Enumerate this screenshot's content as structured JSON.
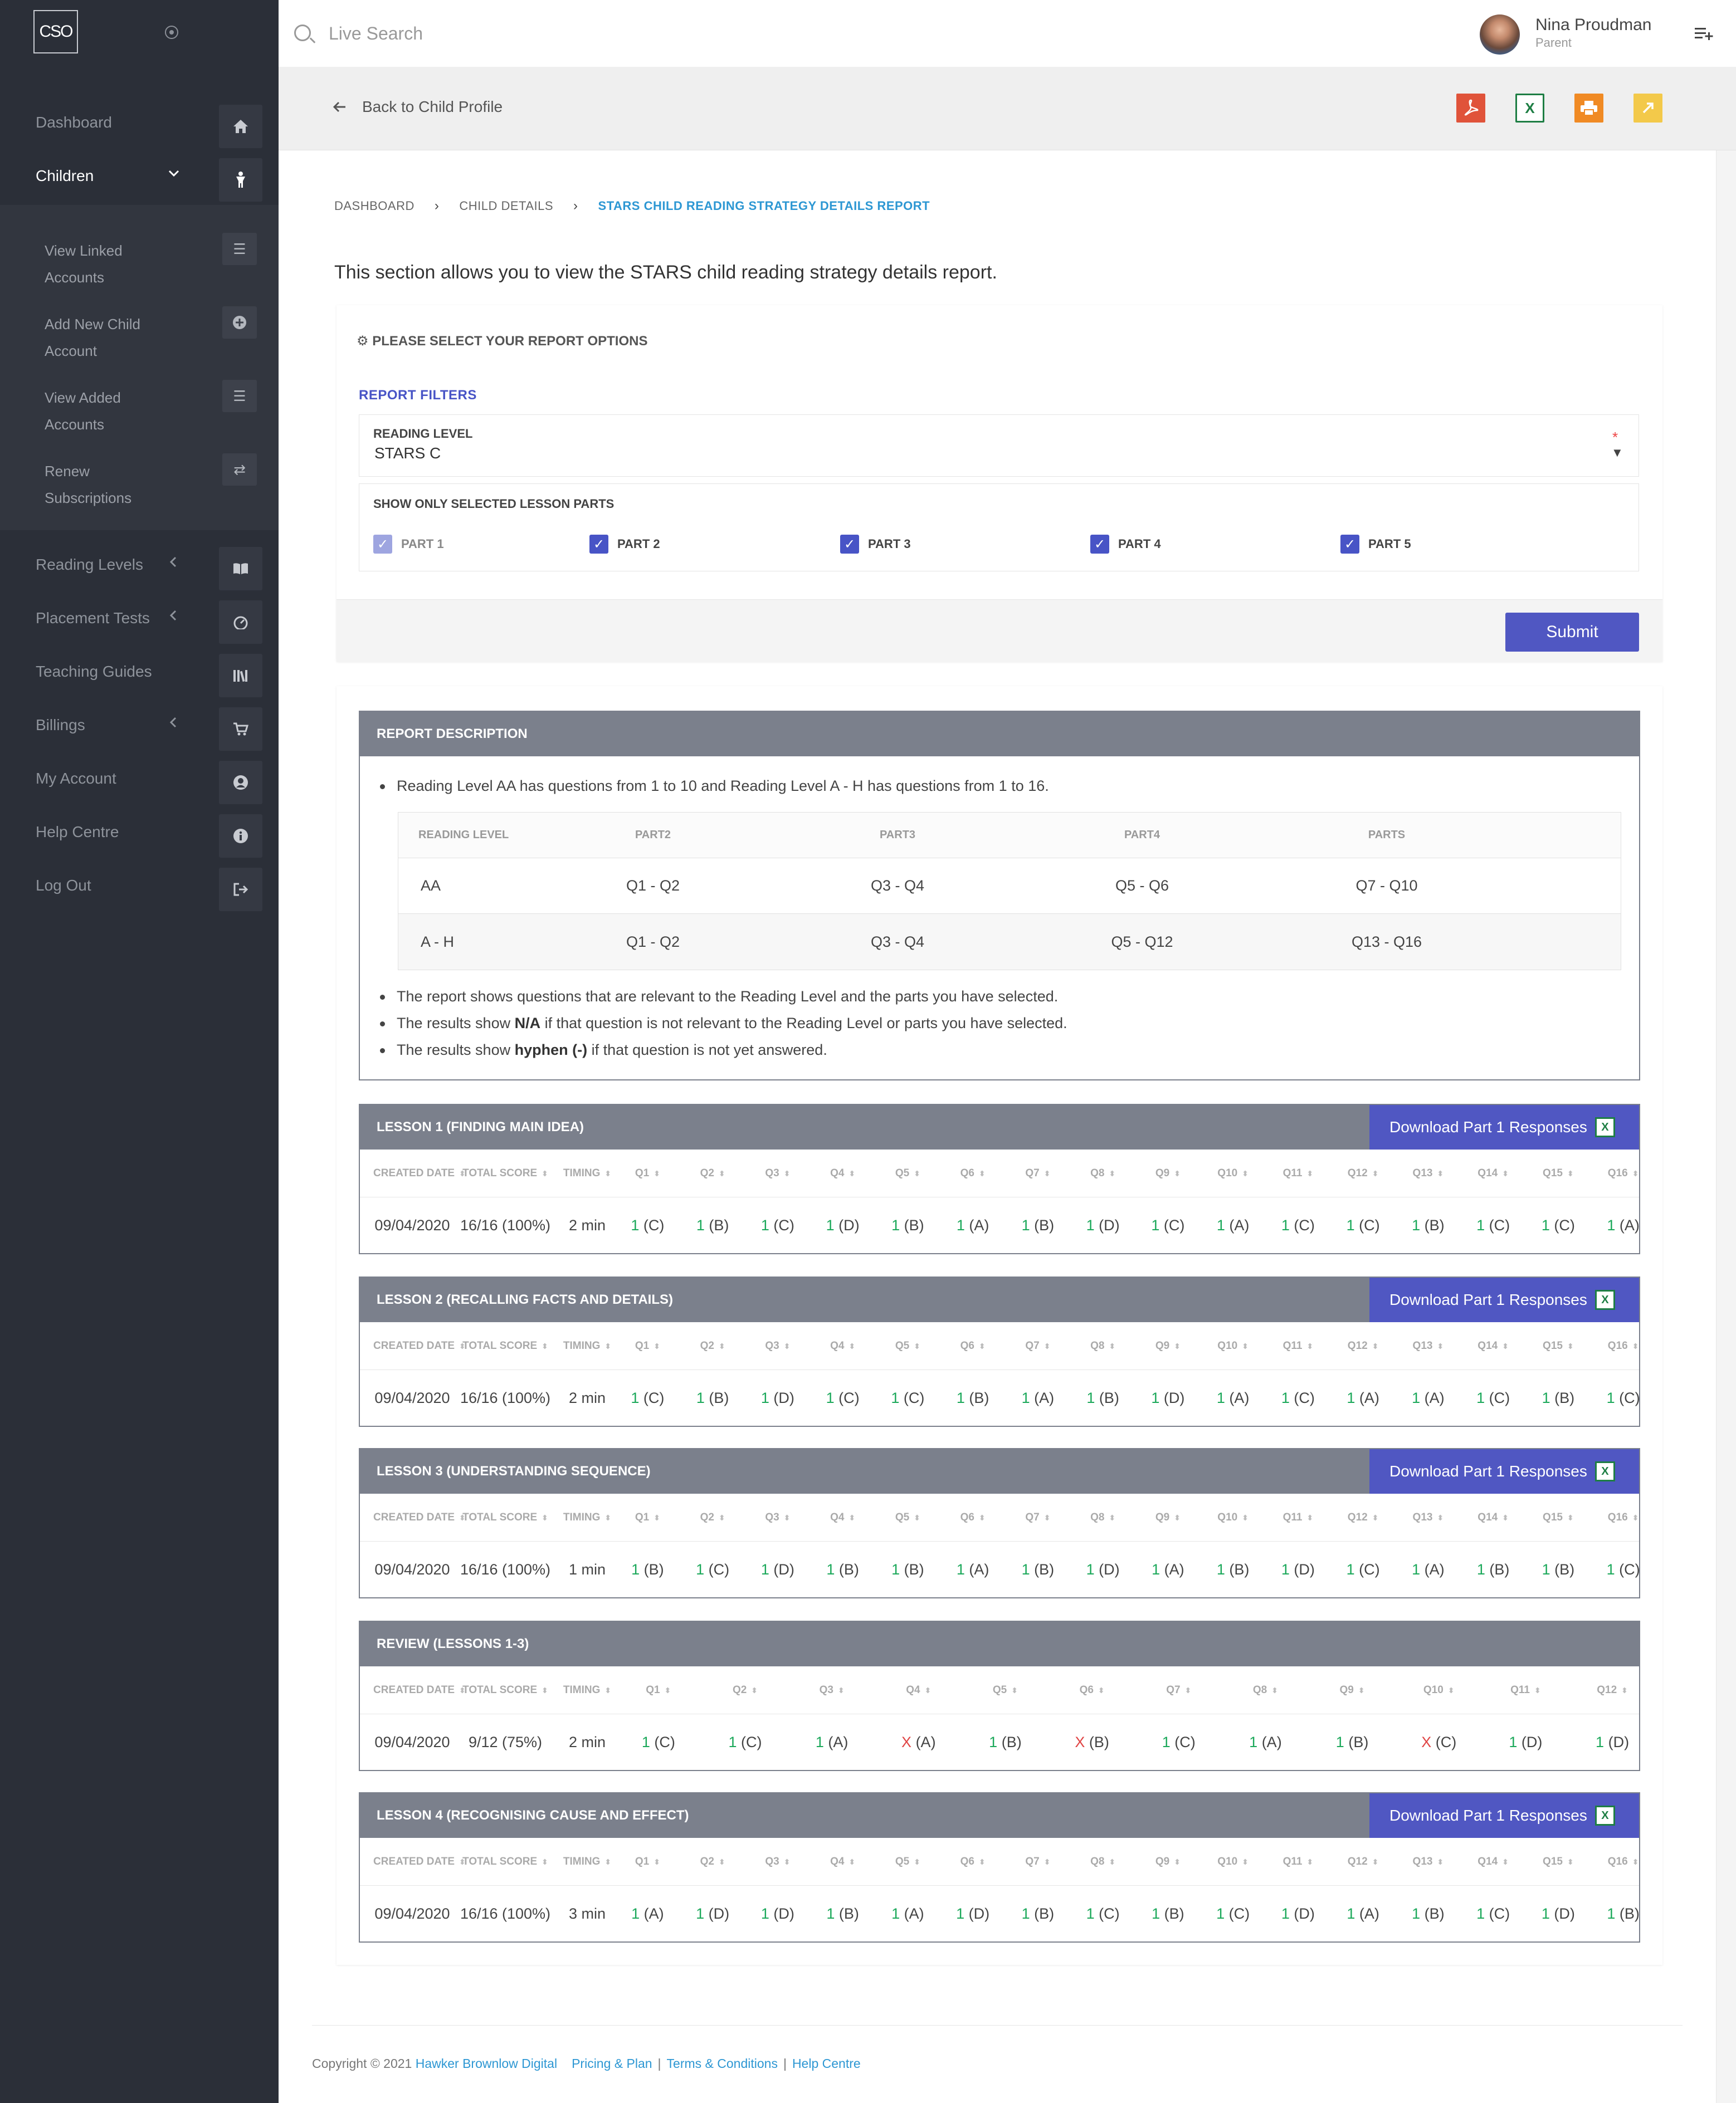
{
  "topbar": {
    "search_placeholder": "Live Search",
    "user_name": "Nina Proudman",
    "user_role": "Parent"
  },
  "sidebar": {
    "logo_text": "CSO",
    "items": [
      {
        "label": "Dashboard",
        "icon": "home-icon"
      },
      {
        "label": "Children",
        "icon": "child-icon",
        "active": true,
        "chevron": "down"
      },
      {
        "label": "Reading Levels",
        "icon": "book-icon",
        "chevron": "left"
      },
      {
        "label": "Placement Tests",
        "icon": "gauge-icon",
        "chevron": "left"
      },
      {
        "label": "Teaching Guides",
        "icon": "library-icon"
      },
      {
        "label": "Billings",
        "icon": "cart-icon",
        "chevron": "left"
      },
      {
        "label": "My Account",
        "icon": "user-circle-icon"
      },
      {
        "label": "Help Centre",
        "icon": "info-icon"
      },
      {
        "label": "Log Out",
        "icon": "logout-icon"
      }
    ],
    "sub_items": [
      {
        "label": "View Linked Accounts",
        "icon": "list-icon"
      },
      {
        "label": "Add New Child Account",
        "icon": "plus-circle-icon"
      },
      {
        "label": "View Added Accounts",
        "icon": "list-icon"
      },
      {
        "label": "Renew Subscriptions",
        "icon": "repeat-icon"
      }
    ]
  },
  "subbar": {
    "back_label": "Back to Child Profile",
    "export_icons": [
      "pdf-icon",
      "excel-icon",
      "print-icon",
      "share-icon"
    ],
    "export_colors": [
      "#e0533a",
      "#1e7e44",
      "#f08a24",
      "#f3c94a"
    ]
  },
  "breadcrumb": [
    "DASHBOARD",
    "CHILD DETAILS",
    "STARS CHILD READING STRATEGY DETAILS REPORT"
  ],
  "intro": "This section allows you to view the STARS child reading strategy details report.",
  "options": {
    "title": "PLEASE SELECT YOUR REPORT OPTIONS",
    "filters_title": "REPORT FILTERS",
    "reading_level_label": "READING LEVEL",
    "reading_level_value": "STARS C",
    "required_mark": "*",
    "parts_label": "SHOW ONLY SELECTED LESSON PARTS",
    "parts": [
      {
        "label": "PART 1",
        "checked": true,
        "disabled": true
      },
      {
        "label": "PART 2",
        "checked": true
      },
      {
        "label": "PART 3",
        "checked": true
      },
      {
        "label": "PART 4",
        "checked": true
      },
      {
        "label": "PART 5",
        "checked": true
      }
    ],
    "submit_label": "Submit"
  },
  "description": {
    "title": "REPORT DESCRIPTION",
    "bullet1": "Reading Level AA has questions from 1 to 10 and Reading Level A - H has questions from 1 to 16.",
    "table_headers": [
      "READING LEVEL",
      "PART2",
      "PART3",
      "PART4",
      "PARTS"
    ],
    "table_rows": [
      [
        "AA",
        "Q1 - Q2",
        "Q3 - Q4",
        "Q5 - Q6",
        "Q7 - Q10"
      ],
      [
        "A - H",
        "Q1 - Q2",
        "Q3 - Q4",
        "Q5 - Q12",
        "Q13 - Q16"
      ]
    ],
    "bullet2": "The report shows questions that are relevant to the Reading Level and the parts you have selected.",
    "bullet3_pre": "The results show ",
    "bullet3_bold": "N/A",
    "bullet3_post": " if that question is not relevant to the Reading Level or parts you have selected.",
    "bullet4_pre": "The results show ",
    "bullet4_bold": "hyphen (-)",
    "bullet4_post": " if that question is not yet answered."
  },
  "lessons": [
    {
      "title": "LESSON 1 (FINDING MAIN IDEA)",
      "download": "Download Part 1 Responses",
      "headers": [
        "CREATED DATE",
        "TOTAL SCORE",
        "TIMING",
        "Q1",
        "Q2",
        "Q3",
        "Q4",
        "Q5",
        "Q6",
        "Q7",
        "Q8",
        "Q9",
        "Q10",
        "Q11",
        "Q12",
        "Q13",
        "Q14",
        "Q15",
        "Q16"
      ],
      "row": {
        "date": "09/04/2020",
        "score": "16/16 (100%)",
        "timing": "2 min",
        "answers": [
          [
            "1",
            "(C)"
          ],
          [
            "1",
            "(B)"
          ],
          [
            "1",
            "(C)"
          ],
          [
            "1",
            "(D)"
          ],
          [
            "1",
            "(B)"
          ],
          [
            "1",
            "(A)"
          ],
          [
            "1",
            "(B)"
          ],
          [
            "1",
            "(D)"
          ],
          [
            "1",
            "(C)"
          ],
          [
            "1",
            "(A)"
          ],
          [
            "1",
            "(C)"
          ],
          [
            "1",
            "(C)"
          ],
          [
            "1",
            "(B)"
          ],
          [
            "1",
            "(C)"
          ],
          [
            "1",
            "(C)"
          ],
          [
            "1",
            "(A)"
          ]
        ]
      }
    },
    {
      "title": "LESSON 2 (RECALLING FACTS AND DETAILS)",
      "download": "Download Part 1 Responses",
      "headers": [
        "CREATED DATE",
        "TOTAL SCORE",
        "TIMING",
        "Q1",
        "Q2",
        "Q3",
        "Q4",
        "Q5",
        "Q6",
        "Q7",
        "Q8",
        "Q9",
        "Q10",
        "Q11",
        "Q12",
        "Q13",
        "Q14",
        "Q15",
        "Q16"
      ],
      "row": {
        "date": "09/04/2020",
        "score": "16/16 (100%)",
        "timing": "2 min",
        "answers": [
          [
            "1",
            "(C)"
          ],
          [
            "1",
            "(B)"
          ],
          [
            "1",
            "(D)"
          ],
          [
            "1",
            "(C)"
          ],
          [
            "1",
            "(C)"
          ],
          [
            "1",
            "(B)"
          ],
          [
            "1",
            "(A)"
          ],
          [
            "1",
            "(B)"
          ],
          [
            "1",
            "(D)"
          ],
          [
            "1",
            "(A)"
          ],
          [
            "1",
            "(C)"
          ],
          [
            "1",
            "(A)"
          ],
          [
            "1",
            "(A)"
          ],
          [
            "1",
            "(C)"
          ],
          [
            "1",
            "(B)"
          ],
          [
            "1",
            "(C)"
          ]
        ]
      }
    },
    {
      "title": "LESSON 3 (UNDERSTANDING SEQUENCE)",
      "download": "Download Part 1 Responses",
      "headers": [
        "CREATED DATE",
        "TOTAL SCORE",
        "TIMING",
        "Q1",
        "Q2",
        "Q3",
        "Q4",
        "Q5",
        "Q6",
        "Q7",
        "Q8",
        "Q9",
        "Q10",
        "Q11",
        "Q12",
        "Q13",
        "Q14",
        "Q15",
        "Q16"
      ],
      "row": {
        "date": "09/04/2020",
        "score": "16/16 (100%)",
        "timing": "1 min",
        "answers": [
          [
            "1",
            "(B)"
          ],
          [
            "1",
            "(C)"
          ],
          [
            "1",
            "(D)"
          ],
          [
            "1",
            "(B)"
          ],
          [
            "1",
            "(B)"
          ],
          [
            "1",
            "(A)"
          ],
          [
            "1",
            "(B)"
          ],
          [
            "1",
            "(D)"
          ],
          [
            "1",
            "(A)"
          ],
          [
            "1",
            "(B)"
          ],
          [
            "1",
            "(D)"
          ],
          [
            "1",
            "(C)"
          ],
          [
            "1",
            "(A)"
          ],
          [
            "1",
            "(B)"
          ],
          [
            "1",
            "(B)"
          ],
          [
            "1",
            "(C)"
          ]
        ]
      }
    },
    {
      "title": "REVIEW (LESSONS 1-3)",
      "download": "",
      "headers": [
        "CREATED DATE",
        "TOTAL SCORE",
        "TIMING",
        "Q1",
        "Q2",
        "Q3",
        "Q4",
        "Q5",
        "Q6",
        "Q7",
        "Q8",
        "Q9",
        "Q10",
        "Q11",
        "Q12"
      ],
      "row": {
        "date": "09/04/2020",
        "score": "9/12 (75%)",
        "timing": "2 min",
        "answers": [
          [
            "1",
            "(C)"
          ],
          [
            "1",
            "(C)"
          ],
          [
            "1",
            "(A)"
          ],
          [
            "X",
            "(A)"
          ],
          [
            "1",
            "(B)"
          ],
          [
            "X",
            "(B)"
          ],
          [
            "1",
            "(C)"
          ],
          [
            "1",
            "(A)"
          ],
          [
            "1",
            "(B)"
          ],
          [
            "X",
            "(C)"
          ],
          [
            "1",
            "(D)"
          ],
          [
            "1",
            "(D)"
          ]
        ]
      }
    },
    {
      "title": "LESSON 4 (RECOGNISING CAUSE AND EFFECT)",
      "download": "Download Part 1 Responses",
      "headers": [
        "CREATED DATE",
        "TOTAL SCORE",
        "TIMING",
        "Q1",
        "Q2",
        "Q3",
        "Q4",
        "Q5",
        "Q6",
        "Q7",
        "Q8",
        "Q9",
        "Q10",
        "Q11",
        "Q12",
        "Q13",
        "Q14",
        "Q15",
        "Q16"
      ],
      "row": {
        "date": "09/04/2020",
        "score": "16/16 (100%)",
        "timing": "3 min",
        "answers": [
          [
            "1",
            "(A)"
          ],
          [
            "1",
            "(D)"
          ],
          [
            "1",
            "(D)"
          ],
          [
            "1",
            "(B)"
          ],
          [
            "1",
            "(A)"
          ],
          [
            "1",
            "(D)"
          ],
          [
            "1",
            "(B)"
          ],
          [
            "1",
            "(C)"
          ],
          [
            "1",
            "(B)"
          ],
          [
            "1",
            "(C)"
          ],
          [
            "1",
            "(D)"
          ],
          [
            "1",
            "(A)"
          ],
          [
            "1",
            "(B)"
          ],
          [
            "1",
            "(C)"
          ],
          [
            "1",
            "(D)"
          ],
          [
            "1",
            "(B)"
          ]
        ]
      }
    }
  ],
  "footer": {
    "copyright": "Copyright © 2021",
    "company": "Hawker Brownlow Digital",
    "links": [
      "Pricing & Plan",
      "Terms & Conditions",
      "Help Centre"
    ]
  },
  "colors": {
    "sidebar_bg": "#2b2f38",
    "accent": "#5057c2",
    "panel_header": "#7b808c",
    "link": "#2d97d3",
    "correct": "#1ba85a",
    "wrong": "#e04444"
  }
}
